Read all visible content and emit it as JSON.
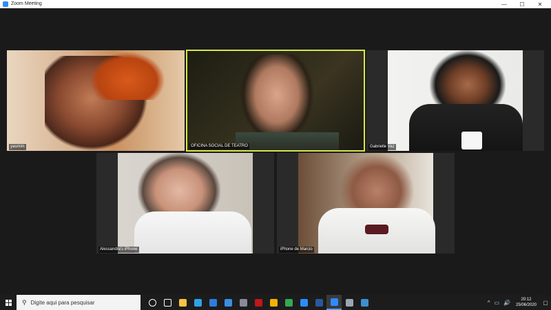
{
  "window": {
    "title": "Zoom Meeting",
    "controls": {
      "minimize": "—",
      "maximize": "☐",
      "close": "✕"
    }
  },
  "participants": [
    {
      "name": "yasmim"
    },
    {
      "name": "OFICINA SOCIAL DE TEATRO",
      "active_speaker": true,
      "highlight_color": "#d6e84a"
    },
    {
      "name": "Gabrielle Vaz"
    },
    {
      "name": "Alessandra's iPhone"
    },
    {
      "name": "iPhone de Marcio"
    }
  ],
  "taskbar": {
    "search_placeholder": "Digite aqui para pesquisar",
    "search_icon": "magnifier-icon",
    "apps": [
      {
        "icon": "cortana-icon",
        "color": "#ffffff"
      },
      {
        "icon": "task-view-icon",
        "color": "#ffffff"
      },
      {
        "icon": "file-explorer-icon",
        "color": "#f4c542"
      },
      {
        "icon": "edge-icon",
        "color": "#2fa3e6"
      },
      {
        "icon": "store-icon",
        "color": "#2d7de0"
      },
      {
        "icon": "mail-icon",
        "color": "#3a8fe0"
      },
      {
        "icon": "app-circle-icon",
        "color": "#8a8a9a"
      },
      {
        "icon": "mcafee-icon",
        "color": "#c0161c"
      },
      {
        "icon": "chrome-canary-icon",
        "color": "#f0b400"
      },
      {
        "icon": "chrome-icon",
        "color": "#34a853"
      },
      {
        "icon": "zoom-icon",
        "color": "#2d8cff"
      },
      {
        "icon": "word-icon",
        "color": "#2b579a"
      },
      {
        "icon": "zoom-meeting-icon",
        "color": "#2d8cff",
        "active": true
      },
      {
        "icon": "globe-icon",
        "color": "#9aa6b2"
      },
      {
        "icon": "photos-icon",
        "color": "#3f8fcf"
      }
    ],
    "tray": {
      "chevron": "^",
      "display": "▭",
      "speaker": "🔊"
    },
    "clock": {
      "time": "20:12",
      "date": "25/06/2020"
    },
    "notifications_icon": "▢"
  }
}
